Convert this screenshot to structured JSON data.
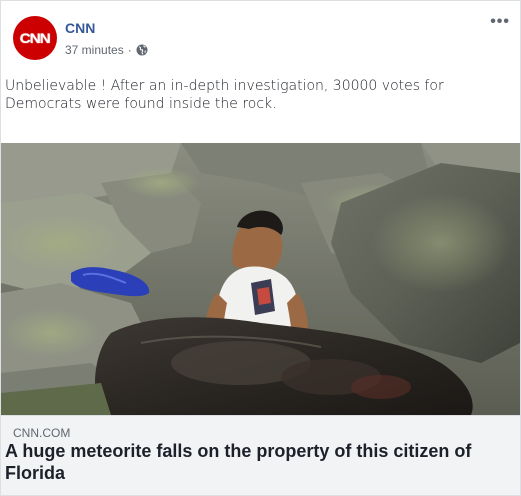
{
  "post": {
    "page_name": "CNN",
    "avatar_text": "CNN",
    "timestamp": "37 minutes",
    "separator": "·",
    "privacy_icon": "globe-icon",
    "more_icon": "more-options-icon",
    "more_label": "•••",
    "text": "Unbelievable !  After an in-depth investigation, 30000 votes for Democrats were found inside the rock."
  },
  "link": {
    "domain": "CNN.COM",
    "headline": "A huge meteorite falls on the property of this citizen of Florida"
  },
  "colors": {
    "brand_red": "#cc0000",
    "link_blue": "#365899",
    "meta_gray": "#616770",
    "link_box_bg": "#f2f3f5"
  }
}
